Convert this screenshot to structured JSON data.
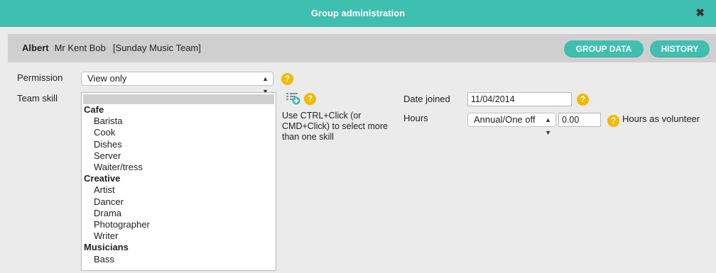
{
  "dialog": {
    "title": "Group administration",
    "close_glyph": "✖"
  },
  "member": {
    "first_name": "Albert",
    "last_name": "Mr Kent Bob",
    "team": "[Sunday Music Team]"
  },
  "actions": {
    "group_data": "GROUP DATA",
    "history": "HISTORY"
  },
  "permission": {
    "label": "Permission",
    "value": "View only"
  },
  "team_skill": {
    "label": "Team skill",
    "hint": "Use CTRL+Click (or CMD+Click) to select more than one skill",
    "groups": [
      {
        "name": "Cafe",
        "options": [
          "Barista",
          "Cook",
          "Dishes",
          "Server",
          "Waiter/tress"
        ]
      },
      {
        "name": "Creative",
        "options": [
          "Artist",
          "Dancer",
          "Drama",
          "Photographer",
          "Writer"
        ]
      },
      {
        "name": "Musicians",
        "options": [
          "Bass"
        ]
      }
    ]
  },
  "date_joined": {
    "label": "Date joined",
    "value": "11/04/2014"
  },
  "hours": {
    "label": "Hours",
    "frequency": "Annual/One off",
    "value": "0.00",
    "suffix": "Hours as volunteer"
  },
  "help_glyph": "?",
  "colors": {
    "accent": "#3fbfb0",
    "help": "#f5b800",
    "background": "#ebebeb"
  }
}
